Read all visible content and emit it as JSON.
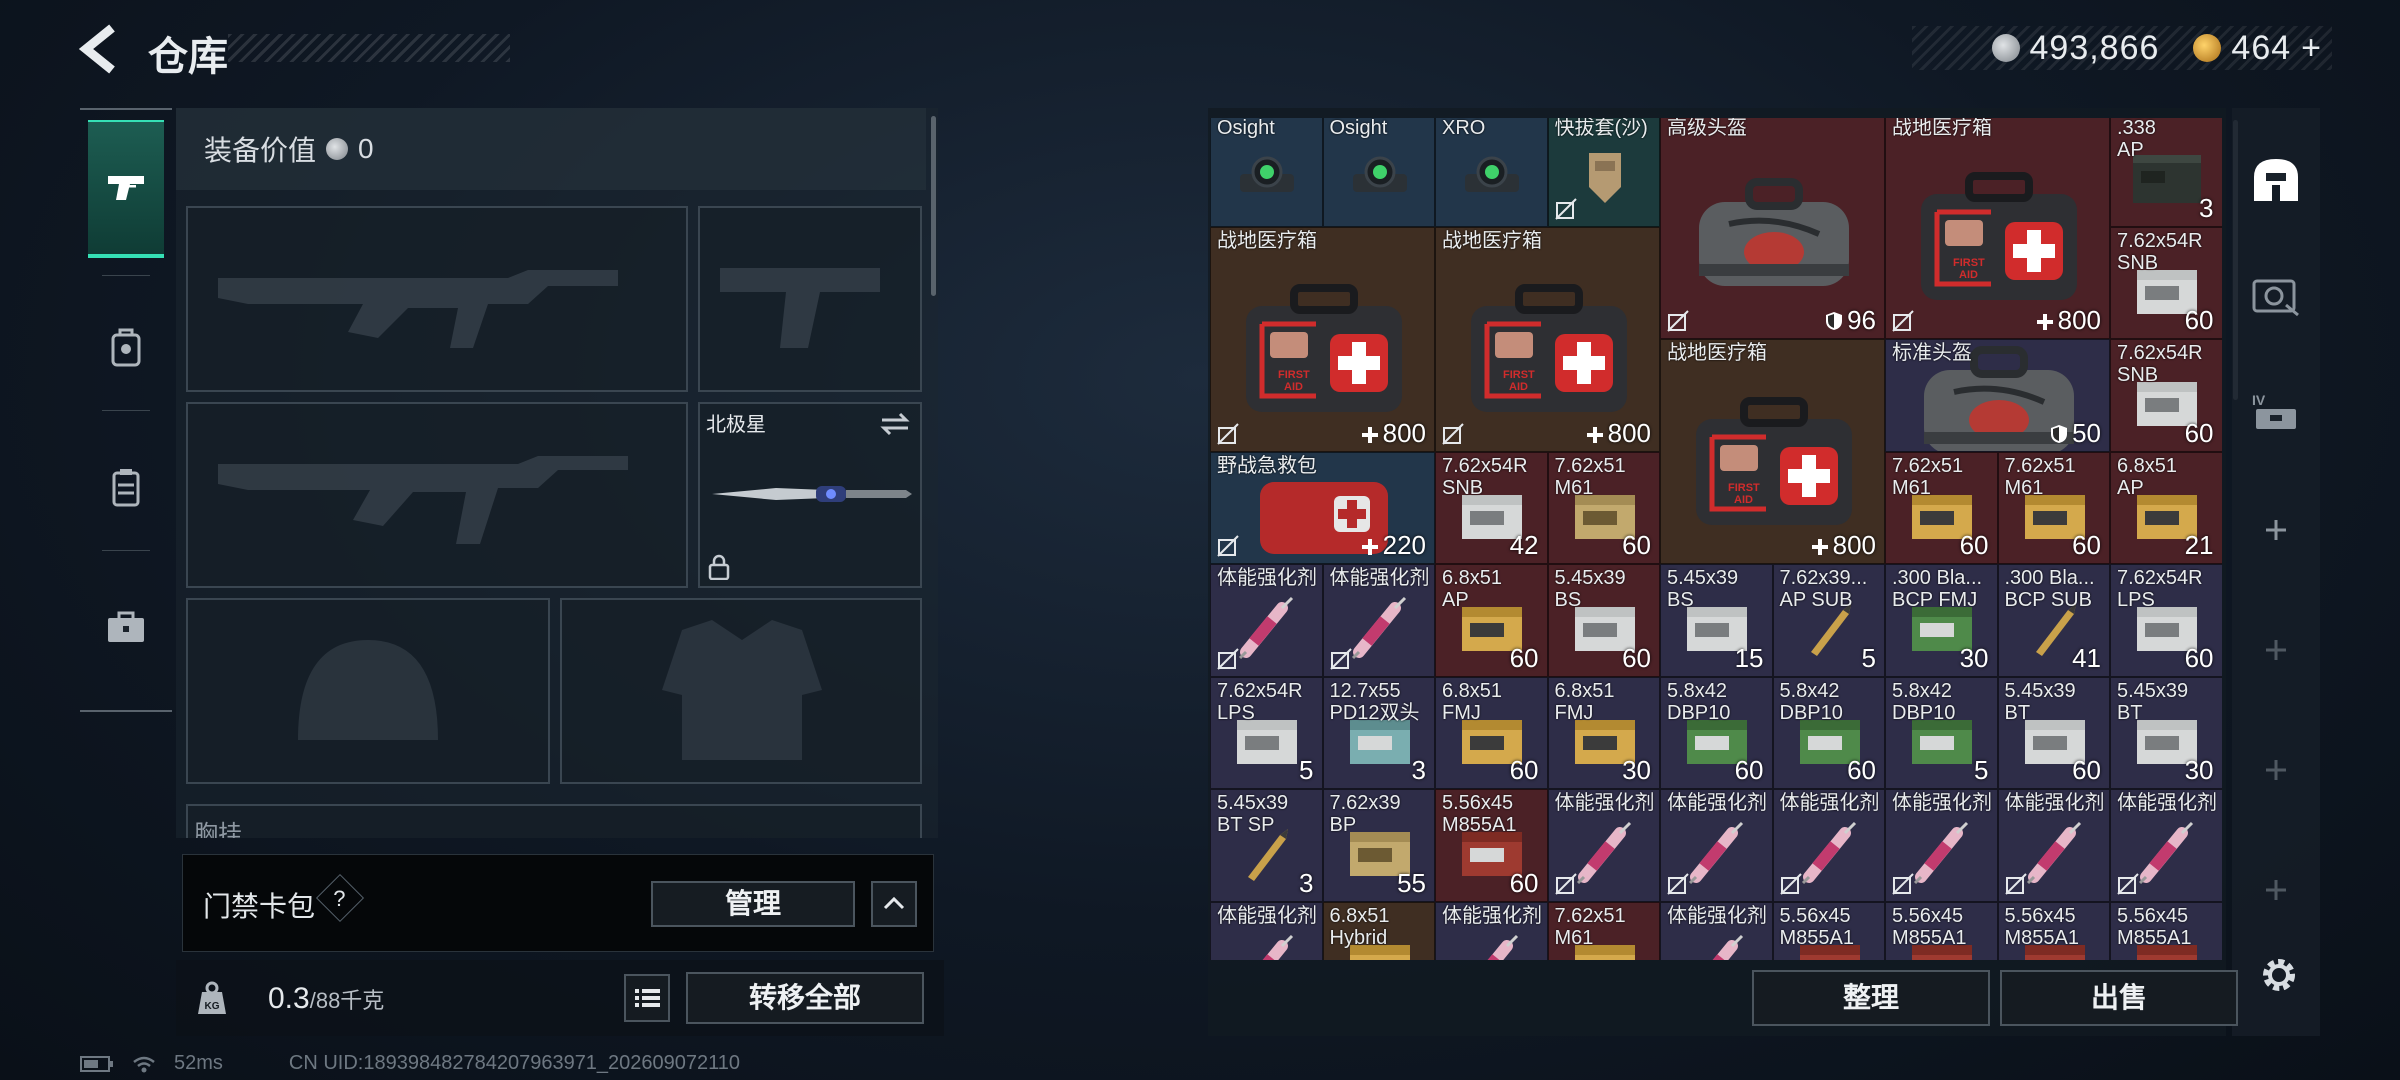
{
  "header": {
    "title": "仓库",
    "silver": "493,866",
    "gold": "464",
    "gold_plus": "+"
  },
  "left_nav": {
    "items": [
      "gun-icon",
      "backpack-icon",
      "vest-icon",
      "briefcase-icon"
    ]
  },
  "equipment": {
    "value_label": "装备价值",
    "value": "0",
    "melee_name": "北极星",
    "chest_label": "胸挂",
    "chest_help": "?"
  },
  "keycard": {
    "label": "门禁卡包",
    "help": "?",
    "manage": "管理"
  },
  "weight": {
    "current": "0.3",
    "max": "/88千克",
    "transfer": "转移全部"
  },
  "status": {
    "ping": "52ms",
    "uid": "CN UID:189398482784207963971_202609072110"
  },
  "inventory": {
    "cells": [
      {
        "label": "Osight",
        "count": "",
        "bg": "bg-blue",
        "img": "scope",
        "nolock": false
      },
      {
        "label": "Osight",
        "count": "",
        "bg": "bg-blue",
        "img": "scope",
        "nolock": false
      },
      {
        "label": "XRO",
        "count": "",
        "bg": "bg-blue",
        "img": "scope",
        "nolock": false
      },
      {
        "label": "快拔套(沙)",
        "count": "",
        "bg": "bg-teal",
        "img": "holster",
        "nolock": true
      },
      {
        "label": "高级头盔",
        "count": "96",
        "bg": "bg-red",
        "img": "bag",
        "nolock": true,
        "shield": true
      },
      {
        "label": "战地医疗箱",
        "count": "800",
        "bg": "bg-red",
        "img": "medkit",
        "nolock": true,
        "plus": true
      },
      {
        "label": ".338\nAP",
        "count": "3",
        "bg": "bg-red",
        "img": "ammo-box",
        "nolock": false
      },
      {
        "label": "战地医疗箱",
        "count": "800",
        "bg": "bg-brown",
        "img": "medkit",
        "nolock": true,
        "plus": true
      },
      {
        "label": "战地医疗箱",
        "count": "800",
        "bg": "bg-brown",
        "img": "medkit",
        "nolock": true,
        "plus": true
      },
      {
        "label": "7.62x54R\nSNB",
        "count": "60",
        "bg": "bg-red",
        "img": "ammo-white",
        "nolock": false
      },
      {
        "label": "战地医疗箱",
        "count": "800",
        "bg": "bg-brown",
        "img": "medkit",
        "nolock": false,
        "plus": true
      },
      {
        "label": "标准头盔",
        "count": "50",
        "bg": "bg-purple",
        "img": "bag",
        "nolock": false,
        "shield": true
      },
      {
        "label": "7.62x54R\nSNB",
        "count": "60",
        "bg": "bg-red",
        "img": "ammo-white",
        "nolock": false
      },
      {
        "label": "野战急救包",
        "count": "220",
        "bg": "bg-blue",
        "img": "redkit",
        "nolock": true,
        "plus": true
      },
      {
        "label": "7.62x54R\nSNB",
        "count": "42",
        "bg": "bg-red",
        "img": "ammo-white",
        "nolock": false
      },
      {
        "label": "7.62x51\nM61",
        "count": "60",
        "bg": "bg-red",
        "img": "ammo-tan",
        "nolock": false
      },
      {
        "label": "7.62x51\nM61",
        "count": "60",
        "bg": "bg-red",
        "img": "ammo-gold",
        "nolock": false
      },
      {
        "label": "7.62x51\nM61",
        "count": "60",
        "bg": "bg-red",
        "img": "ammo-gold",
        "nolock": false
      },
      {
        "label": "6.8x51\nAP",
        "count": "21",
        "bg": "bg-red",
        "img": "ammo-gold",
        "nolock": false
      },
      {
        "label": "体能强化剂",
        "count": "",
        "bg": "bg-purple",
        "img": "syringe",
        "nolock": true
      },
      {
        "label": "体能强化剂",
        "count": "",
        "bg": "bg-purple",
        "img": "syringe",
        "nolock": true
      },
      {
        "label": "6.8x51\nAP",
        "count": "60",
        "bg": "bg-red",
        "img": "ammo-gold",
        "nolock": false
      },
      {
        "label": "5.45x39\nBS",
        "count": "60",
        "bg": "bg-red",
        "img": "ammo-white",
        "nolock": false
      },
      {
        "label": "5.45x39\nBS",
        "count": "15",
        "bg": "bg-purple",
        "img": "ammo-white",
        "nolock": false
      },
      {
        "label": "7.62x39...\nAP SUB",
        "count": "5",
        "bg": "bg-purple",
        "img": "bullet",
        "nolock": false
      },
      {
        "label": ".300 Bla...\nBCP FMJ",
        "count": "30",
        "bg": "bg-purple",
        "img": "ammo-green",
        "nolock": false
      },
      {
        "label": ".300 Bla...\nBCP SUB",
        "count": "41",
        "bg": "bg-purple",
        "img": "bullet",
        "nolock": false
      },
      {
        "label": "7.62x54R\nLPS",
        "count": "60",
        "bg": "bg-purple",
        "img": "ammo-white",
        "nolock": false
      },
      {
        "label": "7.62x54R\nLPS",
        "count": "5",
        "bg": "bg-purple",
        "img": "ammo-white",
        "nolock": false
      },
      {
        "label": "12.7x55\nPD12双头",
        "count": "3",
        "bg": "bg-purple",
        "img": "ammo-teal",
        "nolock": false
      },
      {
        "label": "6.8x51\nFMJ",
        "count": "60",
        "bg": "bg-purple",
        "img": "ammo-gold",
        "nolock": false
      },
      {
        "label": "6.8x51\nFMJ",
        "count": "30",
        "bg": "bg-purple",
        "img": "ammo-gold",
        "nolock": false
      },
      {
        "label": "5.8x42\nDBP10",
        "count": "60",
        "bg": "bg-purple",
        "img": "ammo-green",
        "nolock": false
      },
      {
        "label": "5.8x42\nDBP10",
        "count": "60",
        "bg": "bg-purple",
        "img": "ammo-green",
        "nolock": false
      },
      {
        "label": "5.8x42\nDBP10",
        "count": "5",
        "bg": "bg-purple",
        "img": "ammo-green",
        "nolock": false
      },
      {
        "label": "5.45x39\nBT",
        "count": "60",
        "bg": "bg-purple",
        "img": "ammo-white",
        "nolock": false
      },
      {
        "label": "5.45x39\nBT",
        "count": "30",
        "bg": "bg-purple",
        "img": "ammo-white",
        "nolock": false
      },
      {
        "label": "5.45x39\nBT SP",
        "count": "3",
        "bg": "bg-purple",
        "img": "bullet",
        "nolock": false
      },
      {
        "label": "7.62x39\nBP",
        "count": "55",
        "bg": "bg-purple",
        "img": "ammo-tan",
        "nolock": false
      },
      {
        "label": "5.56x45\nM855A1",
        "count": "60",
        "bg": "bg-red",
        "img": "ammo-red",
        "nolock": false
      },
      {
        "label": "体能强化剂",
        "count": "",
        "bg": "bg-purple",
        "img": "syringe",
        "nolock": true
      },
      {
        "label": "体能强化剂",
        "count": "",
        "bg": "bg-purple",
        "img": "syringe",
        "nolock": true
      },
      {
        "label": "体能强化剂",
        "count": "",
        "bg": "bg-purple",
        "img": "syringe",
        "nolock": true
      },
      {
        "label": "体能强化剂",
        "count": "",
        "bg": "bg-purple",
        "img": "syringe",
        "nolock": true
      },
      {
        "label": "体能强化剂",
        "count": "",
        "bg": "bg-purple",
        "img": "syringe",
        "nolock": true
      },
      {
        "label": "体能强化剂",
        "count": "",
        "bg": "bg-purple",
        "img": "syringe",
        "nolock": true
      },
      {
        "label": "体能强化剂",
        "count": "",
        "bg": "bg-purple",
        "img": "syringe",
        "nolock": false
      },
      {
        "label": "6.8x51\nHybrid",
        "count": "",
        "bg": "bg-brown",
        "img": "ammo-gold",
        "nolock": false
      },
      {
        "label": "体能强化剂",
        "count": "",
        "bg": "bg-purple",
        "img": "syringe",
        "nolock": false
      },
      {
        "label": "7.62x51\nM61",
        "count": "",
        "bg": "bg-red",
        "img": "ammo-gold",
        "nolock": false
      },
      {
        "label": "体能强化剂",
        "count": "",
        "bg": "bg-purple",
        "img": "syringe",
        "nolock": false
      },
      {
        "label": "5.56x45\nM855A1",
        "count": "",
        "bg": "bg-purple",
        "img": "ammo-red",
        "nolock": false
      },
      {
        "label": "5.56x45\nM855A1",
        "count": "",
        "bg": "bg-purple",
        "img": "ammo-red",
        "nolock": false
      },
      {
        "label": "5.56x45\nM855A1",
        "count": "",
        "bg": "bg-purple",
        "img": "ammo-red",
        "nolock": false
      },
      {
        "label": "5.56x45\nM855A1",
        "count": "",
        "bg": "bg-purple",
        "img": "ammo-red",
        "nolock": false
      }
    ]
  },
  "actions": {
    "sort": "整理",
    "sell": "出售"
  },
  "colors": {
    "accent": "#35e0b5",
    "panel": "#151b21"
  }
}
